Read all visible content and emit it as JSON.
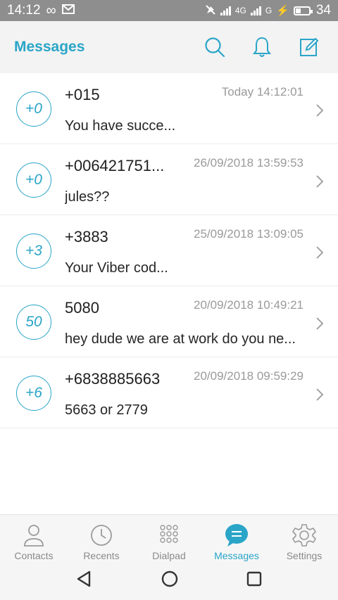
{
  "status_bar": {
    "time": "14:12",
    "network_label": "4G",
    "carrier_label": "G",
    "battery_level": "34",
    "battery_fraction": 0.34
  },
  "header": {
    "title": "Messages",
    "icons": [
      "search-icon",
      "bell-icon",
      "compose-icon"
    ]
  },
  "conversations": [
    {
      "avatar": "+0",
      "name": "+015",
      "time": "Today 14:12:01",
      "preview": "You have succe..."
    },
    {
      "avatar": "+0",
      "name": "+006421751...",
      "time": "26/09/2018 13:59:53",
      "preview": "jules??"
    },
    {
      "avatar": "+3",
      "name": "+3883",
      "time": "25/09/2018 13:09:05",
      "preview": "Your Viber cod..."
    },
    {
      "avatar": "50",
      "name": "5080",
      "time": "20/09/2018 10:49:21",
      "preview": "hey dude we are at work do you ne..."
    },
    {
      "avatar": "+6",
      "name": "+6838885663",
      "time": "20/09/2018 09:59:29",
      "preview": "5663 or 2779"
    }
  ],
  "tabs": [
    {
      "label": "Contacts",
      "icon": "contacts-icon",
      "active": false
    },
    {
      "label": "Recents",
      "icon": "clock-icon",
      "active": false
    },
    {
      "label": "Dialpad",
      "icon": "dialpad-icon",
      "active": false
    },
    {
      "label": "Messages",
      "icon": "messages-icon",
      "active": true
    },
    {
      "label": "Settings",
      "icon": "gear-icon",
      "active": false
    }
  ],
  "colors": {
    "accent": "#2aa5c8",
    "status_bar": "#8e8e8e",
    "header_bg": "#f3f3f3"
  }
}
